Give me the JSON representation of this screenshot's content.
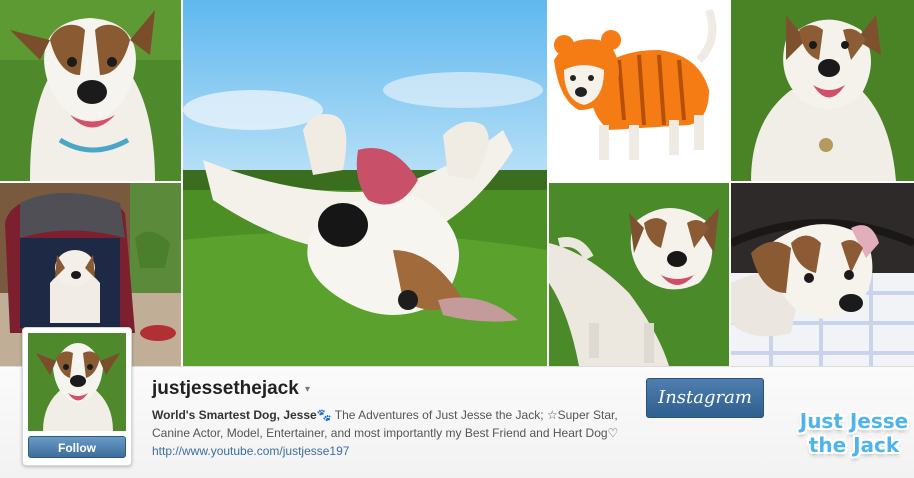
{
  "profile": {
    "username": "justjessethejack",
    "caret": "▾",
    "follow_label": "Follow",
    "bio_bold": "World's Smartest Dog, Jesse🐾",
    "bio_text": " The Adventures of Just Jesse the Jack; ☆Super Star, Canine Actor, Model, Entertainer, and most importantly my Best Friend and Heart Dog♡",
    "website": "http://www.youtube.com/justjesse197"
  },
  "brand": {
    "instagram_label": "Instagram"
  },
  "watermark": {
    "line1": "Just Jesse",
    "line2": "the Jack"
  },
  "colors": {
    "grass": "#4f8f2a",
    "sky": "#7cc3ee",
    "follow_blue": "#3d6d9a",
    "watermark_blue": "#4fb4ee"
  },
  "photos": [
    {
      "name": "dog-portrait-grass"
    },
    {
      "name": "dog-rolling-on-back-sky"
    },
    {
      "name": "dog-orange-tiger-costume"
    },
    {
      "name": "dog-sitting-grass"
    },
    {
      "name": "dog-in-pet-carrier"
    },
    {
      "name": "dog-standing-grass"
    },
    {
      "name": "dog-lying-on-blanket"
    }
  ]
}
